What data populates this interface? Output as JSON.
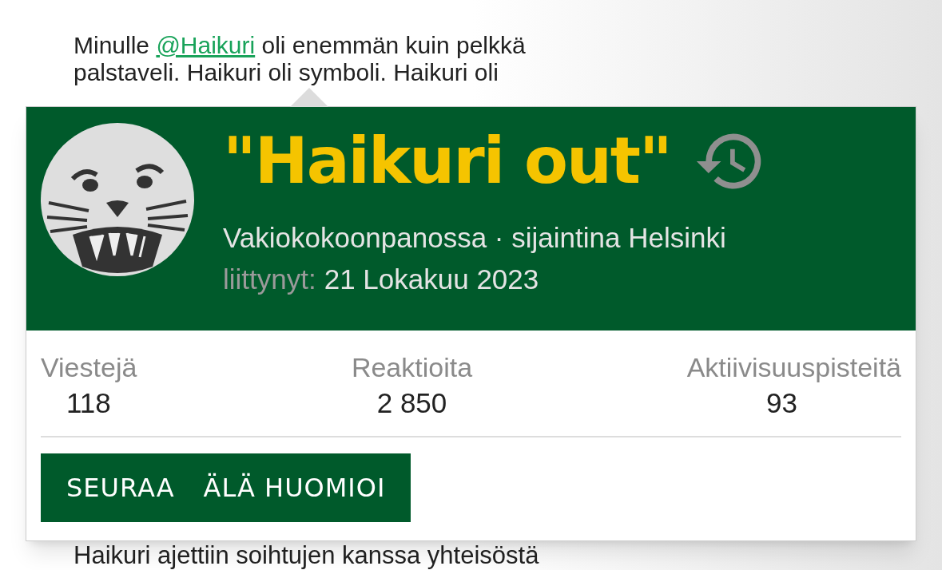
{
  "post": {
    "before_mention": "Minulle ",
    "mention": "@Haikuri",
    "after_mention": " oli enemmän kuin pelkkä",
    "lines": [
      "palstaveli. Haikuri oli symboli. Haikuri oli",
      "Haikuri ajettiin soihtujen kanssa yhteisöstä"
    ]
  },
  "user_card": {
    "name": "\"Haikuri out\"",
    "subtitle": "Vakiokokoonpanossa · sijaintina Helsinki",
    "joined_label": "liittynyt:",
    "joined_date": "21 Lokakuu 2023",
    "stats": [
      {
        "label": "Viestejä",
        "value": "118"
      },
      {
        "label": "Reaktioita",
        "value": "2 850"
      },
      {
        "label": "Aktiivisuuspisteitä",
        "value": "93"
      }
    ],
    "buttons": [
      "SEURAA",
      "ÄLÄ HUOMIOI"
    ]
  }
}
